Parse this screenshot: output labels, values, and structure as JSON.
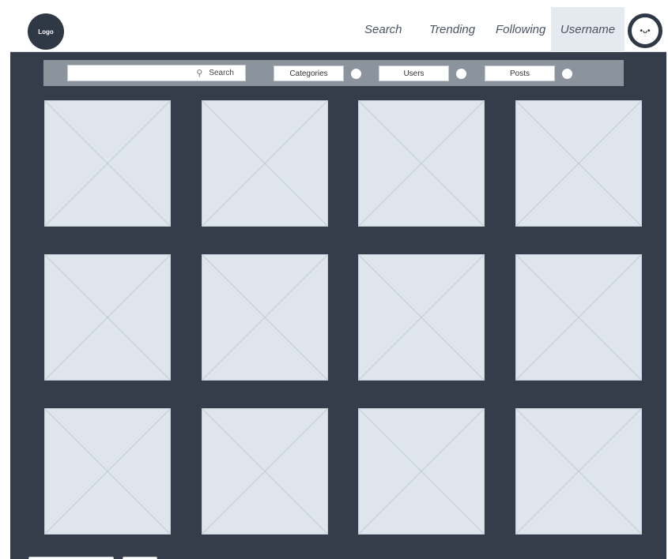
{
  "header": {
    "logo_label": "Logo",
    "nav": [
      "Search",
      "Trending",
      "Following"
    ],
    "username": "Username",
    "avatar_face": "•ᴗ•"
  },
  "filter": {
    "search_label": "Search",
    "search_icon": "search-icon",
    "buttons": [
      "Categories",
      "Users",
      "Posts"
    ]
  },
  "grid": {
    "rows": 3,
    "cols": 4,
    "item_icon": "image-placeholder-icon"
  },
  "colors": {
    "page_bg": "#343d49",
    "filter_bar": "#8b939d",
    "tile_bg": "#dfe5ed",
    "active_tab": "#e5e9f0"
  }
}
